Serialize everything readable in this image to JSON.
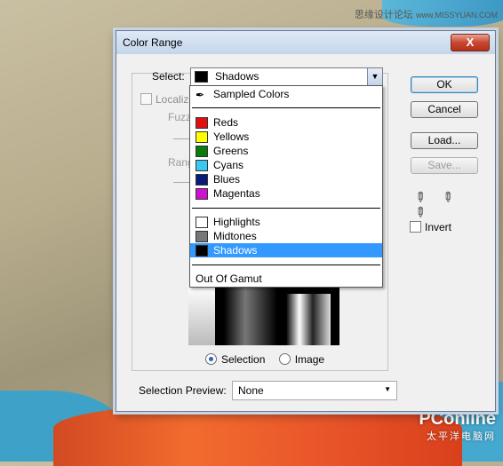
{
  "watermarks": {
    "top_chinese": "思缘设计论坛",
    "top_site": "www.MISSYUAN.COM",
    "bottom_main": "PConline",
    "bottom_sub": "太平洋电脑网"
  },
  "dialog": {
    "title": "Color Range",
    "close_label": "X",
    "select_label": "Select:",
    "select_value": "Shadows",
    "localize_label": "Localize",
    "fuzz_label": "Fuzz",
    "range_label": "Range",
    "radio_selection": "Selection",
    "radio_image": "Image",
    "selection_preview_label": "Selection Preview:",
    "selection_preview_value": "None",
    "buttons": {
      "ok": "OK",
      "cancel": "Cancel",
      "load": "Load...",
      "save": "Save..."
    },
    "invert_label": "Invert"
  },
  "dropdown": {
    "sampled": "Sampled Colors",
    "colors": [
      {
        "label": "Reds",
        "swatch": "#e01010"
      },
      {
        "label": "Yellows",
        "swatch": "#ffff00"
      },
      {
        "label": "Greens",
        "swatch": "#0a7a0a"
      },
      {
        "label": "Cyans",
        "swatch": "#38c8f0"
      },
      {
        "label": "Blues",
        "swatch": "#0a1a7a"
      },
      {
        "label": "Magentas",
        "swatch": "#d010d0"
      }
    ],
    "tones": [
      {
        "label": "Highlights",
        "swatch": "#ffffff"
      },
      {
        "label": "Midtones",
        "swatch": "#777777"
      },
      {
        "label": "Shadows",
        "swatch": "#000000",
        "selected": true
      }
    ],
    "out_of_gamut": "Out Of Gamut"
  },
  "colors": {
    "selection_highlight": "#3399ff",
    "close_button": "#c9462f"
  }
}
